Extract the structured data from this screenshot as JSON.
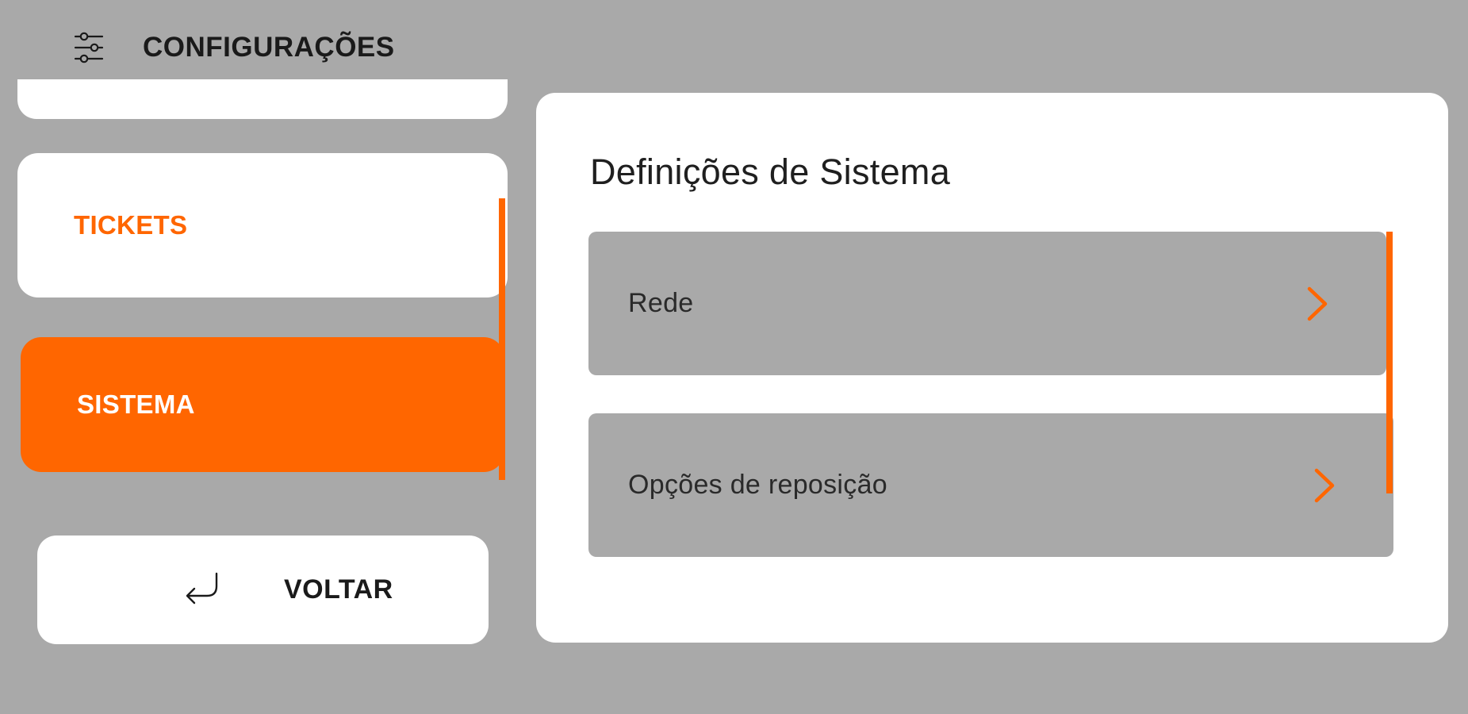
{
  "header": {
    "icon": "sliders-icon",
    "title": "CONFIGURAÇÕES"
  },
  "sidebar": {
    "items": [
      {
        "label": "TICKETS",
        "selected": false
      },
      {
        "label": "SISTEMA",
        "selected": true
      }
    ],
    "back": {
      "icon": "return-arrow-icon",
      "label": "VOLTAR"
    }
  },
  "panel": {
    "title": "Definições de Sistema",
    "options": [
      {
        "label": "Rede",
        "icon": "chevron-right-icon"
      },
      {
        "label": "Opções de reposição",
        "icon": "chevron-right-icon"
      }
    ]
  },
  "colors": {
    "accent": "#ff6600",
    "background": "#a9a9a9",
    "card": "#ffffff"
  }
}
